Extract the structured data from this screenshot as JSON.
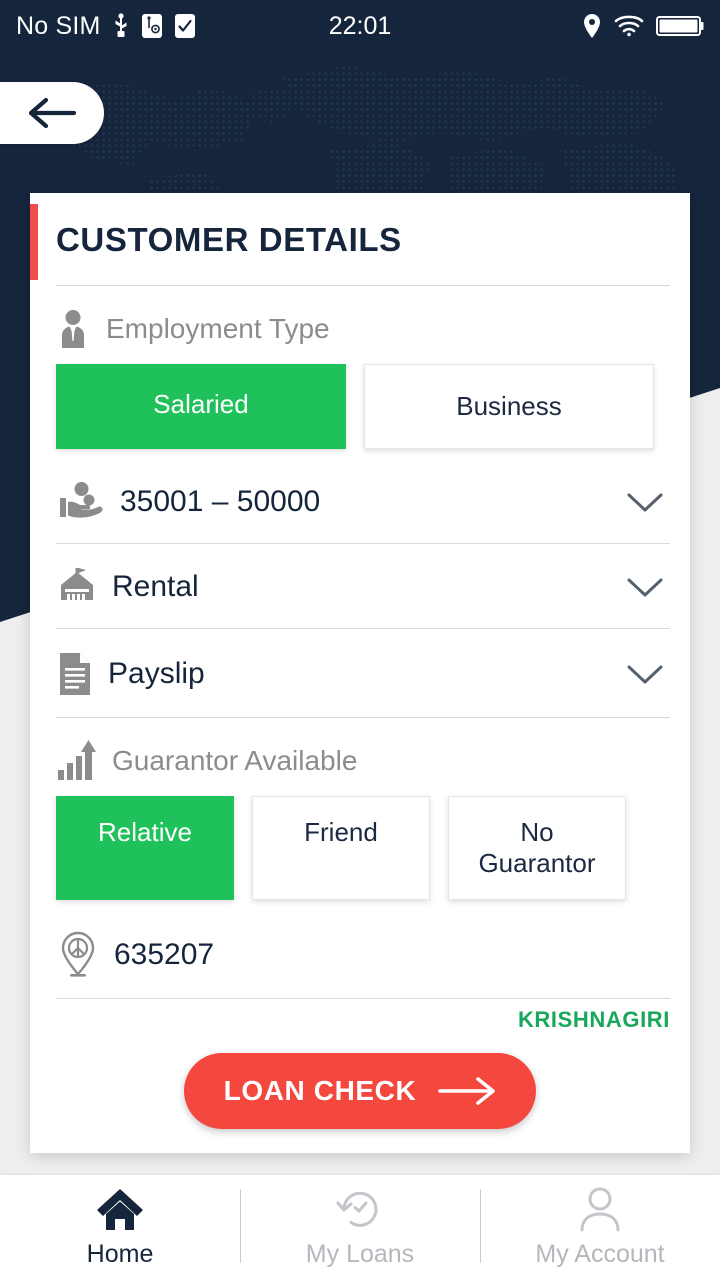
{
  "statusbar": {
    "carrier": "No SIM",
    "time": "22:01",
    "icons_left": [
      "usb-icon",
      "usb-settings-icon",
      "checkbox-checked-icon"
    ],
    "icons_right": [
      "location-icon",
      "wifi-icon",
      "battery-icon"
    ]
  },
  "header": {
    "back_icon": "arrow-left-icon",
    "background_color": "#15253c"
  },
  "card": {
    "title": "CUSTOMER DETAILS",
    "accent_color": "#f04b4b"
  },
  "employment": {
    "icon": "businessman-icon",
    "label": "Employment Type",
    "options": [
      {
        "label": "Salaried",
        "selected": true
      },
      {
        "label": "Business",
        "selected": false
      }
    ]
  },
  "salary": {
    "icon": "hand-money-icon",
    "value": "35001 – 50000",
    "chevron": "chevron-down-icon"
  },
  "residence": {
    "icon": "house-icon",
    "value": "Rental",
    "chevron": "chevron-down-icon"
  },
  "document": {
    "icon": "document-icon",
    "value": "Payslip",
    "chevron": "chevron-down-icon"
  },
  "guarantor": {
    "icon": "growth-chart-icon",
    "label": "Guarantor Available",
    "options": [
      {
        "label": "Relative",
        "selected": true
      },
      {
        "label": "Friend",
        "selected": false
      },
      {
        "label": "No Guarantor",
        "selected": false
      }
    ]
  },
  "pincode": {
    "icon": "map-pin-icon",
    "value": "635207",
    "city": "KRISHNAGIRI",
    "city_color": "#18a75b"
  },
  "cta": {
    "label": "LOAN CHECK",
    "icon": "arrow-right-icon",
    "color": "#f4483f"
  },
  "bottomnav": {
    "items": [
      {
        "label": "Home",
        "icon": "home-icon",
        "active": true
      },
      {
        "label": "My Loans",
        "icon": "history-clock-icon",
        "active": false
      },
      {
        "label": "My Account",
        "icon": "person-icon",
        "active": false
      }
    ]
  },
  "colors": {
    "navy": "#15253c",
    "green": "#1fc15b",
    "red": "#f4483f",
    "page_bg": "#eeeeee"
  }
}
